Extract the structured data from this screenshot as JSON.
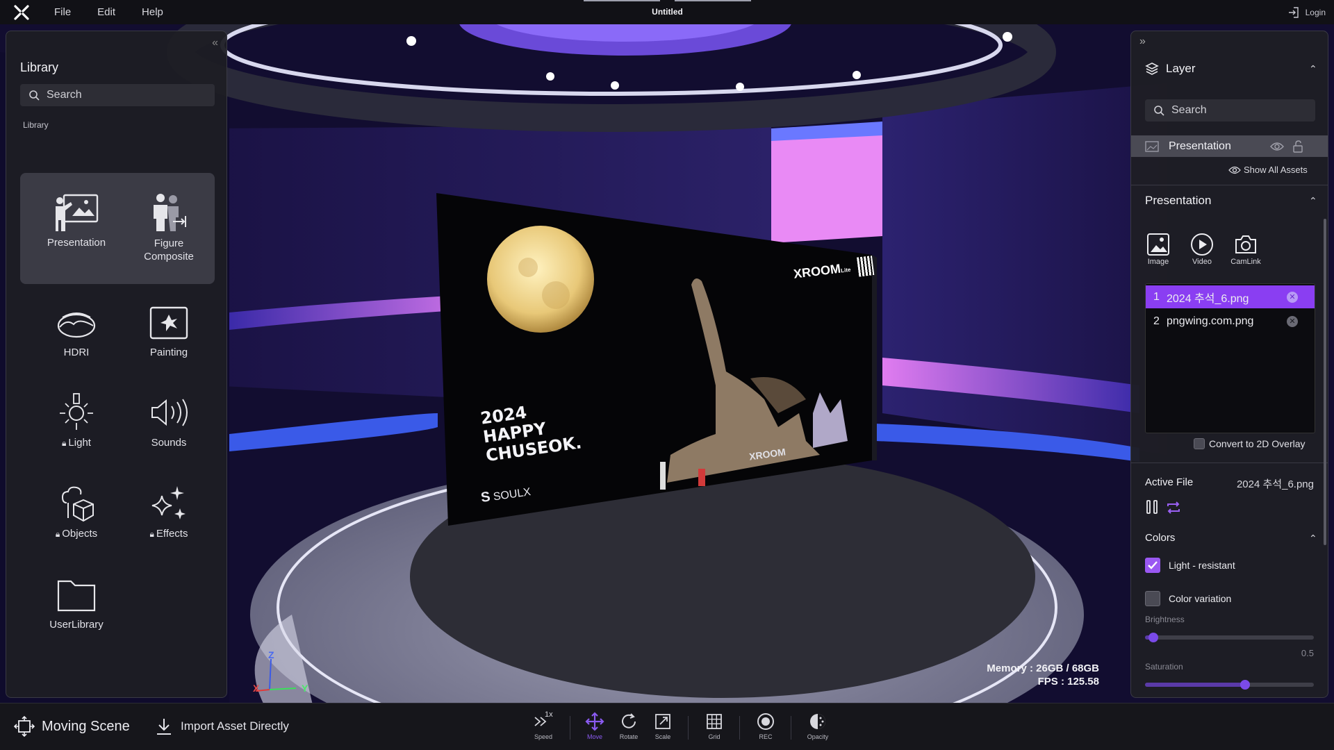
{
  "app": {
    "title": "Untitled",
    "menu": [
      "File",
      "Edit",
      "Help"
    ],
    "login_label": "Login"
  },
  "library": {
    "title": "Library",
    "search_placeholder": "Search",
    "section_label": "Library",
    "items": [
      {
        "label": "Presentation",
        "icon": "presentation-icon",
        "locked": false
      },
      {
        "label": "Figure\nComposite",
        "icon": "figure-composite-icon",
        "locked": false
      },
      {
        "label": "HDRI",
        "icon": "hdri-icon",
        "locked": false
      },
      {
        "label": "Painting",
        "icon": "painting-icon",
        "locked": false
      },
      {
        "label": "Light",
        "icon": "light-icon",
        "locked": true
      },
      {
        "label": "Sounds",
        "icon": "sounds-icon",
        "locked": false
      },
      {
        "label": "Objects",
        "icon": "objects-icon",
        "locked": true
      },
      {
        "label": "Effects",
        "icon": "effects-icon",
        "locked": true
      },
      {
        "label": "UserLibrary",
        "icon": "folder-icon",
        "locked": false
      }
    ]
  },
  "layer": {
    "title": "Layer",
    "search_placeholder": "Search",
    "selected_layer": "Presentation",
    "show_all_assets": "Show All Assets"
  },
  "presentation": {
    "title": "Presentation",
    "media_buttons": [
      "Image",
      "Video",
      "CamLink"
    ],
    "files": [
      {
        "index": "1",
        "name": "2024 추석_6.png",
        "active": true
      },
      {
        "index": "2",
        "name": "pngwing.com.png",
        "active": false
      }
    ],
    "convert_label": "Convert to 2D Overlay",
    "active_file_label": "Active File",
    "active_file_value": "2024 추석_6.png"
  },
  "colors": {
    "title": "Colors",
    "light_resistant_label": "Light - resistant",
    "light_resistant_checked": true,
    "color_variation_label": "Color variation",
    "color_variation_checked": false,
    "brightness_label": "Brightness",
    "brightness_value": "0.5",
    "brightness_fraction": 0.02,
    "saturation_label": "Saturation",
    "saturation_fraction": 0.6
  },
  "viewport": {
    "memory": "Memory : 26GB / 68GB",
    "fps": "FPS : 125.58",
    "axis_labels": {
      "z": "Z",
      "x": "X",
      "y": "Y"
    },
    "screen_text": {
      "line1": "2024",
      "line2": "HAPPY",
      "line3": "CHUSEOK.",
      "brand": "SOULX",
      "logo": "XROOM",
      "logo_sub": "Lite",
      "logo_bottom": "XROOM"
    }
  },
  "toolbar": {
    "moving_scene": "Moving Scene",
    "import_asset": "Import Asset Directly",
    "speed_value": "1x",
    "tools": [
      {
        "label": "Speed"
      },
      {
        "label": "Move"
      },
      {
        "label": "Rotate"
      },
      {
        "label": "Scale"
      },
      {
        "label": "Grid"
      },
      {
        "label": "REC"
      },
      {
        "label": "Opacity"
      }
    ]
  },
  "colors_theme": {
    "accent": "#8a3ef2",
    "panel_bg": "#1e1e24",
    "menubar_bg": "#111116"
  }
}
